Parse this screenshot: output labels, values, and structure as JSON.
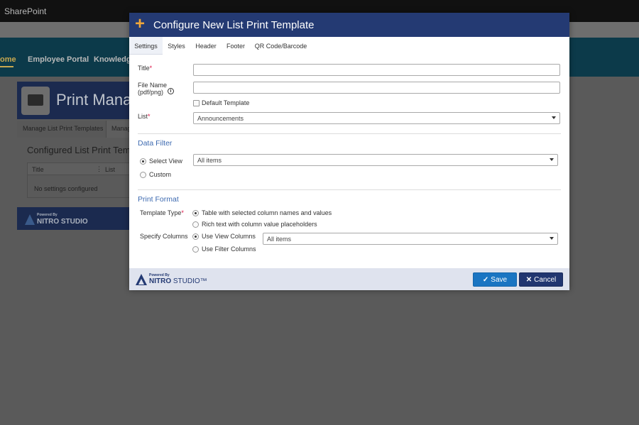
{
  "background": {
    "suitebar_brand": "SharePoint",
    "nav": [
      "ome",
      "Employee Portal",
      "Knowledge"
    ],
    "page_title": "Print Mana",
    "subtabs": [
      "Manage List Print Templates",
      "Manag"
    ],
    "section_title": "Configured List Print Tem",
    "table": {
      "headers": [
        "Title",
        "List"
      ],
      "empty_text": "No settings configured"
    },
    "powered_by": "Powered By",
    "nitro_studio": "NITRO STUDIO"
  },
  "modal": {
    "title": "Configure New List Print Template",
    "tabs": [
      "Settings",
      "Styles",
      "Header",
      "Footer",
      "QR Code/Barcode"
    ],
    "form": {
      "title_label": "Title",
      "title_value": "",
      "filename_label_1": "File Name",
      "filename_label_2": "(pdf/png)",
      "filename_value": "",
      "default_template_label": "Default Template",
      "list_label": "List",
      "list_value": "Announcements"
    },
    "data_filter": {
      "heading": "Data Filter",
      "select_view_label": "Select View",
      "view_value": "All items",
      "custom_label": "Custom"
    },
    "print_format": {
      "heading": "Print Format",
      "template_type_label": "Template Type",
      "template_option_1": "Table with selected column names and values",
      "template_option_2": "Rich text with column value placeholders",
      "specify_columns_label": "Specify Columns",
      "columns_option_1": "Use View Columns",
      "columns_option_2": "Use Filter Columns",
      "columns_view_value": "All items"
    },
    "footer": {
      "powered_by": "Powered By",
      "nitro": "NITRO",
      "studio": " STUDIO™",
      "save_label": "Save",
      "cancel_label": "Cancel"
    }
  }
}
